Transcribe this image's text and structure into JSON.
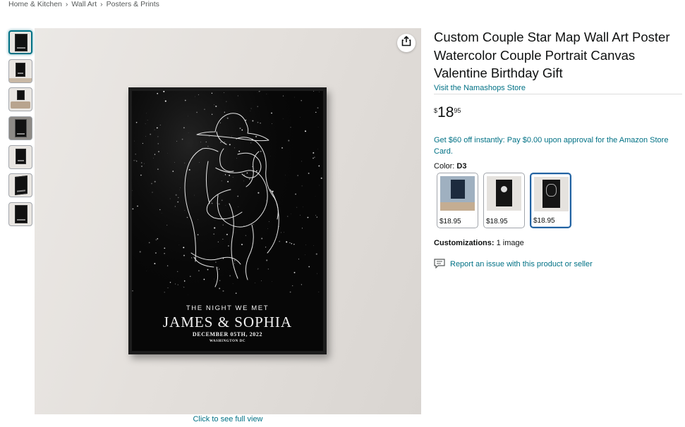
{
  "breadcrumb": [
    "Home & Kitchen",
    "Wall Art",
    "Posters & Prints"
  ],
  "breadcrumb_separator": "›",
  "thumbnails": [
    {
      "selected": true
    },
    {
      "selected": false
    },
    {
      "selected": false
    },
    {
      "selected": false
    },
    {
      "selected": false
    },
    {
      "selected": false
    },
    {
      "selected": false
    }
  ],
  "main_image": {
    "poster": {
      "line1": "THE NIGHT WE MET",
      "line2": "JAMES & SOPHIA",
      "line3": "DECEMBER 05TH, 2022",
      "line4": "WASHINGTON DC"
    },
    "full_view_link": "Click to see full view",
    "share_icon": "share-icon"
  },
  "product": {
    "title": "Custom Couple Star Map Wall Art Poster Watercolor Couple Portrait Canvas Valentine Birthday Gift",
    "store_link": "Visit the Namashops Store",
    "price": {
      "symbol": "$",
      "whole": "18",
      "fraction": "95"
    },
    "promo": "Get $60 off instantly: Pay $0.00 upon approval for the Amazon Store Card.",
    "color_label": "Color: ",
    "color_value": "D3",
    "swatches": [
      {
        "price": "$18.95",
        "selected": false
      },
      {
        "price": "$18.95",
        "selected": false
      },
      {
        "price": "$18.95",
        "selected": true
      }
    ],
    "customizations_label": "Customizations:",
    "customizations_value": " 1 image",
    "report_link": "Report an issue with this product or seller"
  },
  "colors": {
    "link": "#007185",
    "selected_swatch": "#2162a1",
    "text": "#0f1111"
  }
}
